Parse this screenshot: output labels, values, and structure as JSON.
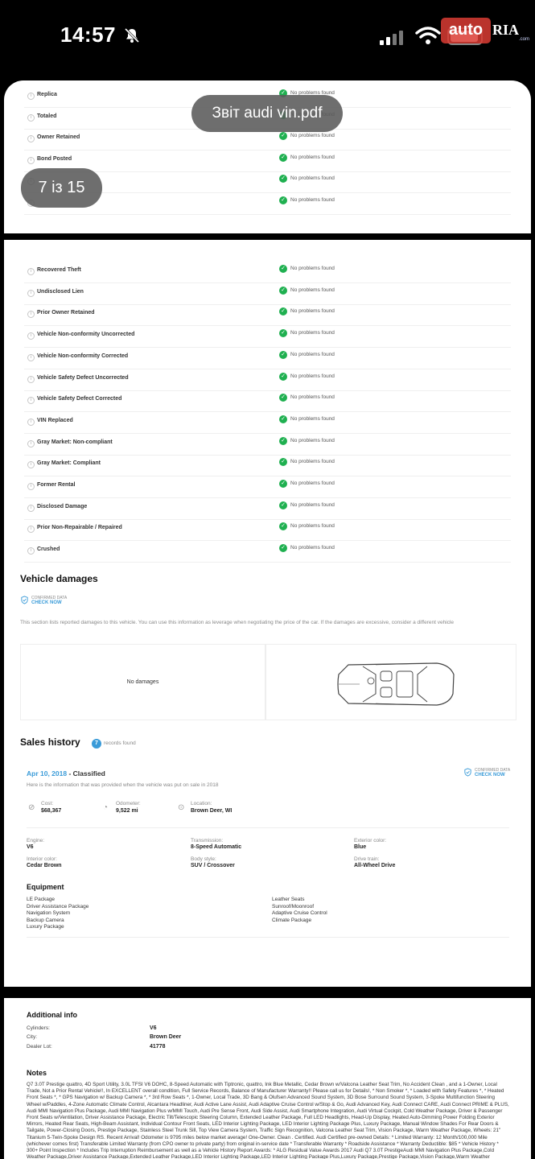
{
  "status_bar": {
    "time": "14:57"
  },
  "watermark": {
    "auto": "auto",
    "ria": "RIA",
    "com": ".com"
  },
  "overlay": {
    "file_title": "Звіт audi vin.pdf",
    "page_counter": "7 із 15"
  },
  "title_checks_top": [
    {
      "label": "Replica",
      "status": "No problems found"
    },
    {
      "label": "Totaled",
      "status": "No problems found"
    },
    {
      "label": "Owner Retained",
      "status": "No problems found"
    },
    {
      "label": "Bond Posted",
      "status": "No problems found"
    },
    {
      "label": "",
      "status": "No problems found"
    },
    {
      "label": "",
      "status": "No problems found"
    }
  ],
  "title_checks": [
    {
      "label": "Recovered Theft",
      "status": "No problems found"
    },
    {
      "label": "Undisclosed Lien",
      "status": "No problems found"
    },
    {
      "label": "Prior Owner Retained",
      "status": "No problems found"
    },
    {
      "label": "Vehicle Non-conformity Uncorrected",
      "status": "No problems found"
    },
    {
      "label": "Vehicle Non-conformity Corrected",
      "status": "No problems found"
    },
    {
      "label": "Vehicle Safety Defect Uncorrected",
      "status": "No problems found"
    },
    {
      "label": "Vehicle Safety Defect Corrected",
      "status": "No problems found"
    },
    {
      "label": "VIN Replaced",
      "status": "No problems found"
    },
    {
      "label": "Gray Market: Non-compliant",
      "status": "No problems found"
    },
    {
      "label": "Gray Market: Compliant",
      "status": "No problems found"
    },
    {
      "label": "Former Rental",
      "status": "No problems found"
    },
    {
      "label": "Disclosed Damage",
      "status": "No problems found"
    },
    {
      "label": "Prior Non-Repairable / Repaired",
      "status": "No problems found"
    },
    {
      "label": "Crushed",
      "status": "No problems found"
    }
  ],
  "damages": {
    "title": "Vehicle damages",
    "confirmed_small": "CONFIRMED DATA",
    "check_now": "CHECK NOW",
    "description": "This section lists reported damages to this vehicle. You can use this information as leverage when negotiating the price of the car. If the damages are excessive, consider a different vehicle",
    "no_damages": "No damages"
  },
  "sales": {
    "title": "Sales history",
    "count": "7",
    "records_found": "records found",
    "date": "Apr 10, 2018",
    "dash_classified": " - Classified",
    "subtitle": "Here is the information that was provided when the vehicle was put on sale in 2018",
    "confirmed_small": "CONFIRMED DATA",
    "check_now": "CHECK NOW",
    "cost_label": "Cost:",
    "cost": "$68,367",
    "odometer_label": "Odometer:",
    "odometer": "9,522 mi",
    "location_label": "Location:",
    "location": "Brown Deer, WI",
    "engine_label": "Engine:",
    "engine": "V6",
    "transmission_label": "Transmission:",
    "transmission": "8-Speed Automatic",
    "exterior_label": "Exterior color:",
    "exterior": "Blue",
    "interior_label": "Interior color:",
    "interior": "Cedar Brown",
    "body_label": "Body style:",
    "body": "SUV / Crossover",
    "drive_label": "Drive train:",
    "drive": "All-Wheel Drive",
    "equipment_title": "Equipment",
    "equipment_left": [
      "LE Package",
      "Driver Assistance Package",
      "Navigation System",
      "Backup Camera",
      "Luxury Package"
    ],
    "equipment_right": [
      "Leather Seats",
      "Sunroof/Moonroof",
      "Adaptive Cruise Control",
      "Climate Package"
    ]
  },
  "additional": {
    "title": "Additional info",
    "cylinders_label": "Cylinders:",
    "cylinders": "V6",
    "city_label": "City:",
    "city": "Brown Deer",
    "lot_label": "Dealer Lot:",
    "lot": "41778",
    "notes_title": "Notes",
    "notes": "Q7 3.0T Prestige quattro, 4D Sport Utility, 3.0L TFSI V6 DOHC, 8-Speed Automatic with Tiptronic, quattro, Ink Blue Metallic, Cedar Brown w/Valcona Leather Seat Trim, No Accident Clean , and a 1-Owner, Local Trade, Not a Prior Rental Vehicle!!, In EXCELLENT overall condition, Full Service Records, Balance of Manufacturer Warranty!! Please call us for Details!, * Non Smoker *, * Loaded with Safety Features *, * Heated Front Seats *, * GPS Navigation w/ Backup Camera *, * 3rd Row Seats *, 1-Owner, Local Trade, 3D Bang & Olufsen Advanced Sound System, 3D Bose Surround Sound System, 3-Spoke Multifunction Steering Wheel w/Paddles, 4-Zone Automatic Climate Control, Alcantara Headliner, Audi Active Lane Assist, Audi Adaptive Cruise Control w/Stop & Go, Audi Advanced Key, Audi Connect CARE, Audi Connect PRIME & PLUS, Audi MMI Navigation Plus Package, Audi MMI Navigation Plus w/MMI Touch, Audi Pre Sense Front, Audi Side Assist, Audi Smartphone Integration, Audi Virtual Cockpit, Cold Weather Package, Driver & Passenger Front Seats w/Ventilation, Driver Assistance Package, Electric Tilt/Telescopic Steering Column, Extended Leather Package, Full LED Headlights, Head-Up Display, Heated Auto-Dimming Power Folding Exterior Mirrors, Heated Rear Seats, High-Beam Assistant, Individual Contour Front Seats, LED Interior Lighting Package, LED Interior Lighting Package Plus, Luxury Package, Manual Window Shades For Rear Doors & Tailgate, Power-Closing Doors, Prestige Package, Stainless Steel Trunk Sill, Top View Camera System, Traffic Sign Recognition, Valcona Leather Seat Trim, Vision Package, Warm Weather Package, Wheels: 21\" Titanium 5-Twin-Spoke Design RS. Recent Arrival! Odometer is 9795 miles below market average! One-Owner. Clean . Certified. Audi Certified pre-owned Details: * Limited Warranty: 12 Month/100,000 Mile (whichever comes first) Transferable Limited Warranty (from CPO owner to private party) from original in-service date * Transferable Warranty * Roadside Assistance * Warranty Deductible: $85 * Vehicle History * 300+ Point Inspection * Includes Trip Interruption Reimbursement as well as a Vehicle History Report Awards: * ALG Residual Value Awards 2017 Audi Q7 3.0T PrestigeAudi MMI Navigation Plus Package,Cold Weather Package,Driver Assistance Package,Extended Leather Package,LED Interior Lighting Package,LED Interior Lighting Package Plus,Luxury Package,Prestige Package,Vision Package,Warm Weather Package,10 Speakers,3D Bang & Olufsen Advanced Sound System,3D Bose Surround Sound System,AM/FM radio: SiriusXM,CD player,Radio data system,Radio: MMI Radio Plus w/Audi Sound System,4-Zone Automatic Climate Control,Air Conditioning,Automatic temperature control,Front dual zone A/C,Rear air conditioning,Rear window"
  }
}
